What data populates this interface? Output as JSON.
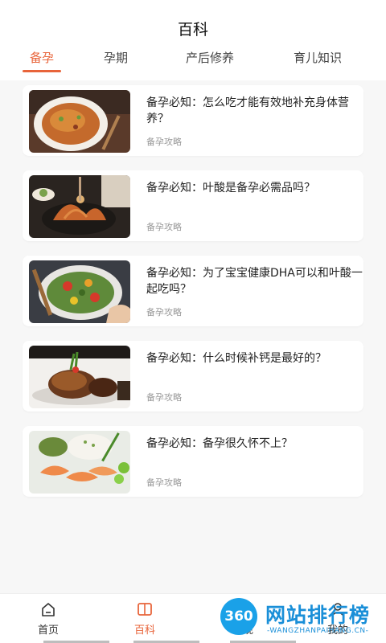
{
  "header": {
    "title": "百科"
  },
  "tabs": [
    {
      "label": "备孕",
      "active": true
    },
    {
      "label": "孕期",
      "active": false
    },
    {
      "label": "产后修养",
      "active": false
    },
    {
      "label": "育儿知识",
      "active": false
    }
  ],
  "articles": [
    {
      "title": "备孕必知：怎么吃才能有效地补充身体营养？",
      "tag": "备孕攻略",
      "image": "fried-noodles-photo"
    },
    {
      "title": "备孕必知：叶酸是备孕必需品吗？",
      "tag": "备孕攻略",
      "image": "pasta-dish-photo"
    },
    {
      "title": "备孕必知：为了宝宝健康DHA可以和叶酸一起吃吗？",
      "tag": "备孕攻略",
      "image": "vegetable-stirfry-photo"
    },
    {
      "title": "备孕必知：什么时候补钙是最好的？",
      "tag": "备孕攻略",
      "image": "grilled-meat-photo"
    },
    {
      "title": "备孕必知：备孕很久怀不上？",
      "tag": "备孕攻略",
      "image": "shrimp-rice-photo"
    }
  ],
  "bottom_nav": [
    {
      "label": "首页",
      "icon": "home-icon",
      "active": false
    },
    {
      "label": "百科",
      "icon": "book-icon",
      "active": true
    },
    {
      "label": "发现",
      "icon": "discover-icon",
      "active": false
    },
    {
      "label": "我的",
      "icon": "profile-icon",
      "active": false
    }
  ],
  "watermark": {
    "badge": "360",
    "text": "网站排行榜",
    "url": "-WANGZHANPAIHANG.CN-"
  },
  "colors": {
    "accent": "#e8643a",
    "watermark": "#1a8fd8"
  }
}
